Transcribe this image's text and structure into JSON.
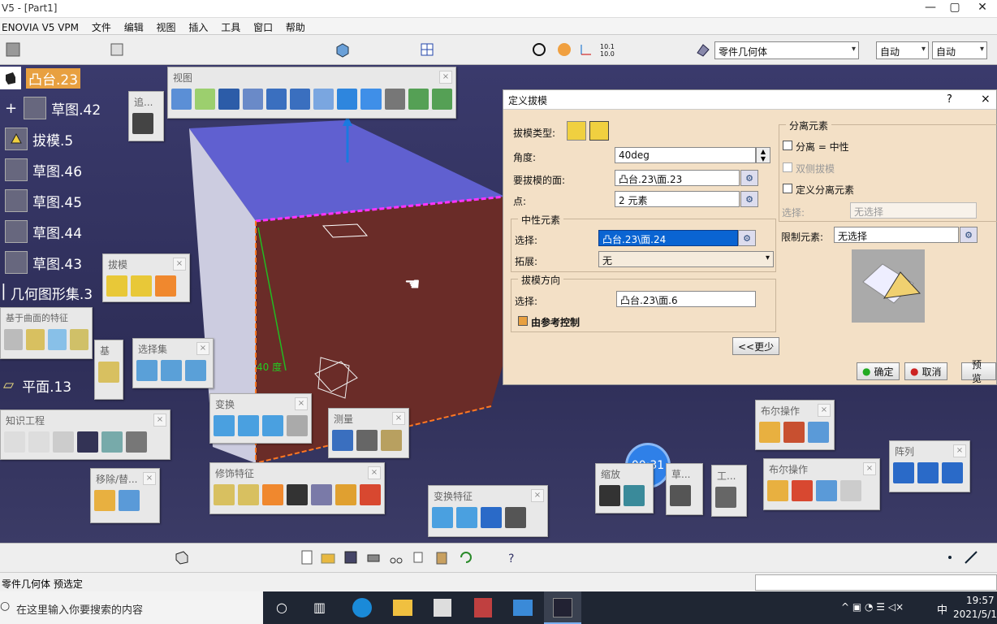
{
  "window": {
    "title": "V5 - [Part1]"
  },
  "menu": [
    "ENOVIA V5 VPM",
    "文件",
    "编辑",
    "视图",
    "插入",
    "工具",
    "窗口",
    "帮助"
  ],
  "toolbar_top": {
    "geometry_select": "零件几何体",
    "mode1": "自动",
    "mode2": "自动"
  },
  "tree": [
    {
      "label": "凸台.23",
      "icon": "pad-icon"
    },
    {
      "label": "草图.42",
      "icon": "sketch-icon"
    },
    {
      "label": "拔模.5",
      "icon": "draft-icon"
    },
    {
      "label": "草图.46",
      "icon": "sketch-icon"
    },
    {
      "label": "草图.45",
      "icon": "sketch-icon"
    },
    {
      "label": "草图.44",
      "icon": "sketch-icon"
    },
    {
      "label": "草图.43",
      "icon": "sketch-icon"
    },
    {
      "label": "几何图形集.3",
      "icon": "geometrical-set-icon"
    },
    {
      "label": "平面.13",
      "icon": "plane-icon"
    }
  ],
  "palettes": {
    "view": "视图",
    "draft": "拔模",
    "surface_features": "基于曲面的特征",
    "selection_set": "选择集",
    "knowledge": "知识工程",
    "transform": "变换",
    "measure": "测量",
    "remove": "移除/替...",
    "dress_up": "修饰特征",
    "transform_features": "变换特征",
    "zoom": "缩放",
    "sketch": "草...",
    "tools": "工...",
    "boolean1": "布尔操作",
    "boolean2": "布尔操作",
    "pattern": "阵列",
    "track": "追...",
    "small": "基"
  },
  "viewport": {
    "angle_label": "40 度"
  },
  "timer": "00:31",
  "dialog": {
    "title": "定义拔模",
    "help": "?",
    "close": "×",
    "draft_type_label": "拔模类型:",
    "angle_label": "角度:",
    "angle_value": "40deg",
    "faces_label": "要拔模的面:",
    "faces_value": "凸台.23\\面.23",
    "points_label": "点:",
    "points_value": "2 元素",
    "neutral_group": "中性元素",
    "neutral_sel_label": "选择:",
    "neutral_sel_value": "凸台.23\\面.24",
    "propagation_label": "拓展:",
    "propagation_value": "无",
    "pulling_group": "拔模方向",
    "pulling_sel_label": "选择:",
    "pulling_sel_value": "凸台.23\\面.6",
    "ref_control": "由参考控制",
    "less_button": "<<更少",
    "parting_group": "分离元素",
    "parting_eq_neutral": "分离 = 中性",
    "draft_both_sides": "双侧拔模",
    "define_parting": "定义分离元素",
    "parting_sel_label": "选择:",
    "parting_sel_value": "无选择",
    "limiting_label": "限制元素:",
    "limiting_value": "无选择",
    "ok": "确定",
    "cancel": "取消",
    "preview": "预览"
  },
  "status": {
    "text": "零件几何体 预选定"
  },
  "taskbar": {
    "search": "在这里输入你要搜索的内容",
    "time": "19:57",
    "date": "2021/5/1",
    "ime": "中"
  }
}
